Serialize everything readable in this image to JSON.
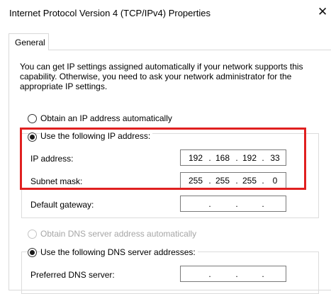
{
  "window": {
    "title": "Internet Protocol Version 4 (TCP/IPv4) Properties",
    "close_glyph": "✕"
  },
  "tabs": [
    {
      "label": "General"
    }
  ],
  "description": "You can get IP settings assigned automatically if your network supports this capability. Otherwise, you need to ask your network administrator for the appropriate IP settings.",
  "ip_mode": {
    "auto_label": "Obtain an IP address automatically",
    "manual_label": "Use the following IP address:",
    "selected": "manual"
  },
  "fields": {
    "ip_address": {
      "label": "IP address:",
      "octets": [
        "192",
        "168",
        "192",
        "33"
      ]
    },
    "subnet_mask": {
      "label": "Subnet mask:",
      "octets": [
        "255",
        "255",
        "255",
        "0"
      ]
    },
    "default_gateway": {
      "label": "Default gateway:",
      "octets": [
        "",
        "",
        "",
        ""
      ]
    }
  },
  "dns_mode": {
    "auto_label": "Obtain DNS server address automatically",
    "manual_label": "Use the following DNS server addresses:",
    "selected": "manual",
    "auto_disabled": true
  },
  "dns_fields": {
    "preferred": {
      "label": "Preferred DNS server:",
      "octets": [
        "",
        "",
        "",
        ""
      ]
    }
  },
  "separator": ".",
  "colors": {
    "highlight": "#e02020",
    "border": "#d9d9d9",
    "disabled_text": "#a6a6a6"
  }
}
